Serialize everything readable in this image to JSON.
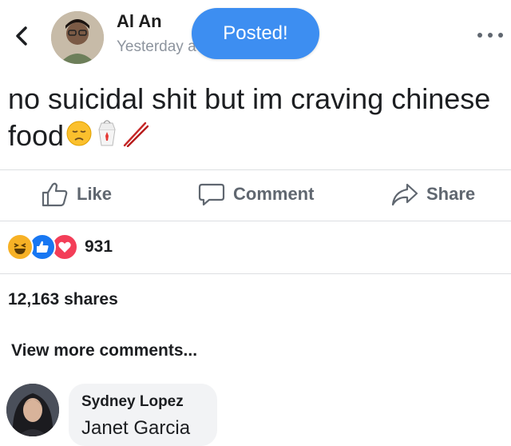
{
  "header": {
    "author_name": "Al An",
    "timestamp": "Yesterday a",
    "toast": "Posted!",
    "icons": {
      "back": "chevron-left-icon",
      "more": "more-horizontal-icon"
    }
  },
  "post": {
    "text": "no suicidal shit but im craving chinese",
    "text_line2": "food",
    "emojis": [
      "pensive-face-emoji",
      "takeout-box-emoji",
      "chopsticks-emoji"
    ]
  },
  "actions": {
    "like": "Like",
    "comment": "Comment",
    "share": "Share"
  },
  "reactions": {
    "types": [
      "haha",
      "like",
      "love"
    ],
    "count": "931"
  },
  "shares_text": "12,163 shares",
  "view_more_comments": "View more comments...",
  "comment": {
    "name": "Sydney Lopez",
    "text": "Janet Garcia"
  },
  "colors": {
    "toast": "#3d8ef1",
    "like_blue": "#1877f2",
    "love_red": "#f33e58",
    "haha_yellow": "#f7b125",
    "action_gray": "#606770",
    "divider": "#dddfe2",
    "bubble": "#f2f3f5"
  }
}
